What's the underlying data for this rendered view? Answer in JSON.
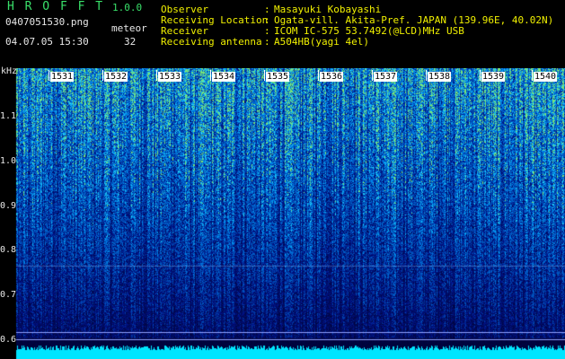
{
  "app": {
    "title": "H R O F F T",
    "version": "1.0.0"
  },
  "capture": {
    "filename": "0407051530.png",
    "datetime": "04.07.05 15:30",
    "meteor_label": "meteor",
    "meteor_count": "32"
  },
  "info": [
    {
      "label": "Observer",
      "value": "Masayuki Kobayashi"
    },
    {
      "label": "Receiving Location",
      "value": "Ogata-vill. Akita-Pref. JAPAN (139.96E, 40.02N)"
    },
    {
      "label": "Receiver",
      "value": "ICOM IC-575 53.7492(@LCD)MHz USB"
    },
    {
      "label": "Receiving antenna",
      "value": "A504HB(yagi 4el)"
    }
  ],
  "info_colon": ":",
  "axis": {
    "y_unit": "kHz",
    "y_ticks": [
      "1.1",
      "1.0",
      "0.9",
      "0.8",
      "0.7",
      "0.6"
    ],
    "x_ticks": [
      "1531",
      "1532",
      "1533",
      "1534",
      "1535",
      "1536",
      "1537",
      "1538",
      "1539",
      "1540"
    ]
  },
  "colors": {
    "background": "#000000",
    "header_green": "#39e06a",
    "header_yellow": "#f0f000",
    "spectrum_low": "#0a1a8a",
    "spectrum_high": "#22d0f0",
    "baseline": "#00e5ff"
  }
}
